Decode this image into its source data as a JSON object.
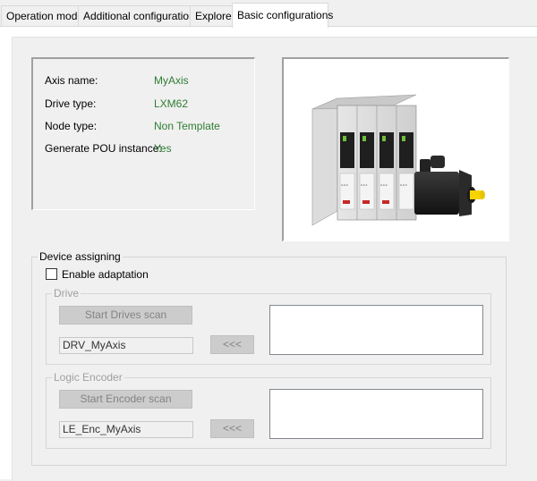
{
  "tabs": [
    {
      "label": "Operation mode"
    },
    {
      "label": "Additional configurations"
    },
    {
      "label": "Explorer"
    },
    {
      "label": "Basic configurations"
    }
  ],
  "info": {
    "axis_name_label": "Axis name:",
    "axis_name_value": "MyAxis",
    "drive_type_label": "Drive type:",
    "drive_type_value": "LXM62",
    "node_type_label": "Node type:",
    "node_type_value": "Non Template",
    "pou_label": "Generate POU instance:",
    "pou_value": "Yes"
  },
  "image": {
    "icon": "servo-drive-and-motor-product-image",
    "label_strips": [
      "0.0.0",
      "0.0.1",
      "0.0.2",
      "0.0.3"
    ]
  },
  "device_assigning": {
    "title": "Device assigning",
    "enable_adaptation_label": "Enable adaptation",
    "enable_adaptation_checked": false,
    "drive": {
      "title": "Drive",
      "scan_button": "Start Drives scan",
      "name_value": "DRV_MyAxis",
      "assign_button": "<<<"
    },
    "logic_encoder": {
      "title": "Logic Encoder",
      "scan_button": "Start Encoder scan",
      "name_value": "LE_Enc_MyAxis",
      "assign_button": "<<<"
    }
  },
  "colors": {
    "value_text": "#2e7d32",
    "disabled_text": "#a0a0a0",
    "panel_bg": "#f0f0f0"
  }
}
